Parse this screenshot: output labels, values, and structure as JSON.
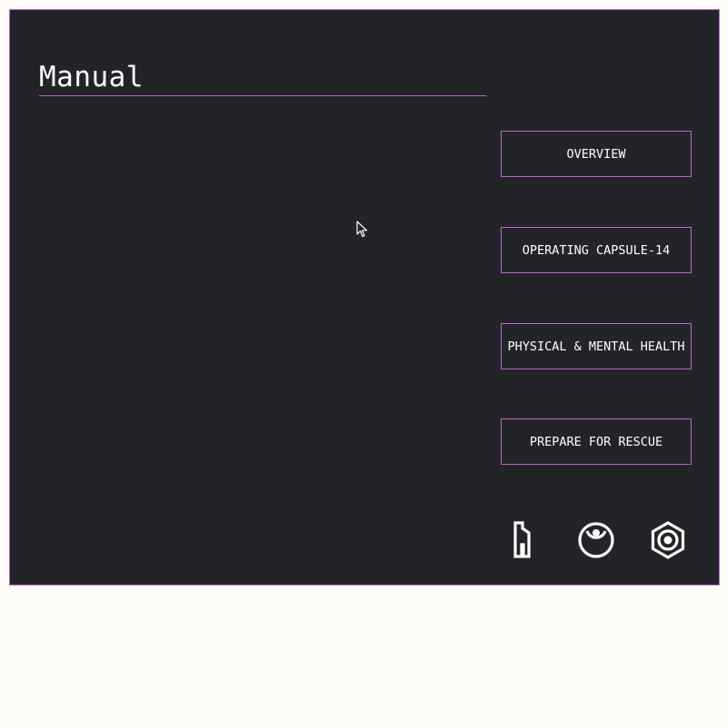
{
  "app": {
    "title": "Manual"
  },
  "menu": {
    "items": [
      {
        "label": "OVERVIEW"
      },
      {
        "label": "OPERATING CAPSULE-14"
      },
      {
        "label": "PHYSICAL & MENTAL HEALTH"
      },
      {
        "label": "PREPARE FOR RESCUE"
      }
    ]
  },
  "toolbar": {
    "icons": [
      "phone-icon",
      "eye-icon",
      "settings-icon"
    ]
  },
  "colors": {
    "panel_bg": "#232428",
    "accent": "#c064c8",
    "text": "#ffffff",
    "page_bg": "#fcfcf8"
  }
}
